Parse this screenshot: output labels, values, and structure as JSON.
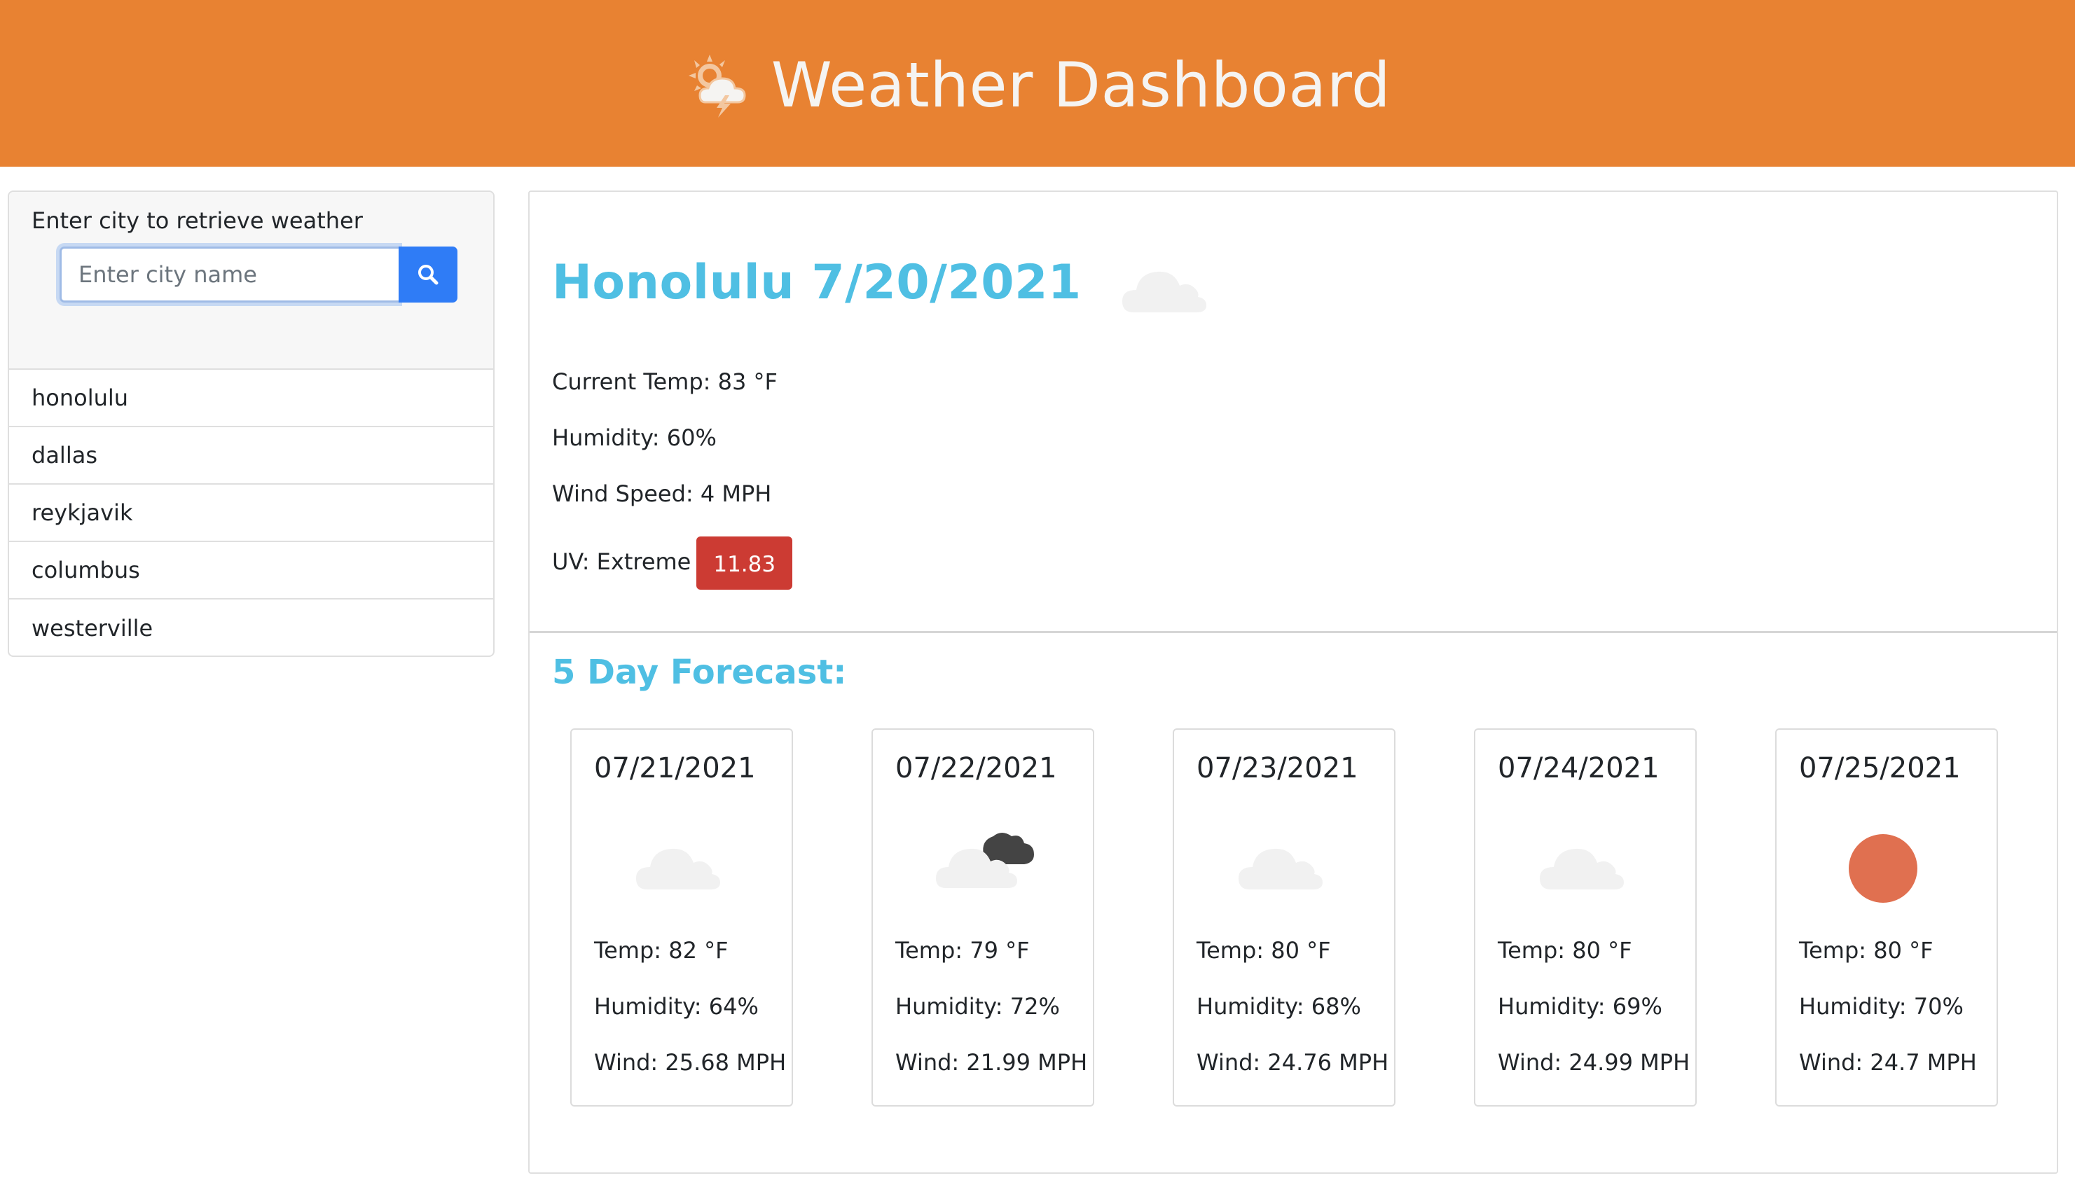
{
  "header": {
    "title": "Weather Dashboard",
    "icon": "sun-cloud-lightning-icon"
  },
  "search": {
    "label": "Enter city to retrieve weather",
    "placeholder": "Enter city name",
    "value": "",
    "button_icon": "search-icon"
  },
  "history": [
    "honolulu",
    "dallas",
    "reykjavik",
    "columbus",
    "westerville"
  ],
  "current": {
    "title": "Honolulu 7/20/2021",
    "icon": "cloud-icon",
    "temp": "Current Temp: 83 °F",
    "humidity": "Humidity: 60%",
    "wind": "Wind Speed: 4 MPH",
    "uv_label": "UV: Extreme",
    "uv_value": "11.83"
  },
  "forecast": {
    "title": "5 Day Forecast:",
    "days": [
      {
        "date": "07/21/2021",
        "icon": "cloud-icon",
        "temp": "Temp: 82 °F",
        "humidity": "Humidity: 64%",
        "wind": "Wind: 25.68 MPH"
      },
      {
        "date": "07/22/2021",
        "icon": "broken-clouds-icon",
        "temp": "Temp: 79 °F",
        "humidity": "Humidity: 72%",
        "wind": "Wind: 21.99 MPH"
      },
      {
        "date": "07/23/2021",
        "icon": "cloud-icon",
        "temp": "Temp: 80 °F",
        "humidity": "Humidity: 68%",
        "wind": "Wind: 24.76 MPH"
      },
      {
        "date": "07/24/2021",
        "icon": "cloud-icon",
        "temp": "Temp: 80 °F",
        "humidity": "Humidity: 69%",
        "wind": "Wind: 24.99 MPH"
      },
      {
        "date": "07/25/2021",
        "icon": "sun-icon",
        "temp": "Temp: 80 °F",
        "humidity": "Humidity: 70%",
        "wind": "Wind: 24.7 MPH"
      }
    ]
  },
  "colors": {
    "header_bg": "#e88232",
    "title_blue": "#4fbfe3",
    "button_blue": "#2f7cf6",
    "uv_red": "#cc3b33",
    "sun": "#e07050"
  }
}
